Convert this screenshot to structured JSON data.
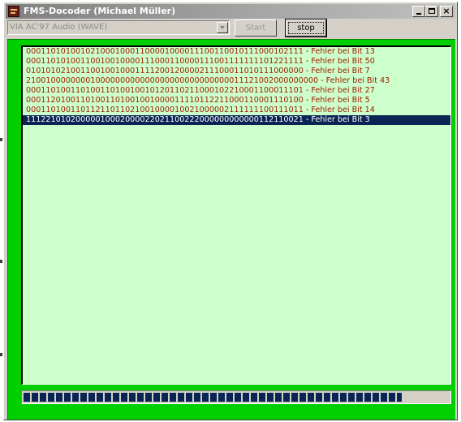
{
  "window": {
    "title": "FMS-Docoder (Michael Müller)",
    "icon": "app-icon",
    "controls": {
      "minimize": "minimize-icon",
      "maximize": "maximize-icon",
      "close": "×"
    }
  },
  "toolbar": {
    "device_value": "VIA AC'97 Audio (WAVE)",
    "start_label": "Start",
    "stop_label": "stop"
  },
  "results": [
    "00011010100102100010001100001000011100110010111000102111 - Fehler bei Bit 13",
    "00011010100110010010000111000110000111001111111101221111 - Fehler bei Bit 50",
    "01010102100110010010001111200120000211100011010111000000 - Fehler bei Bit 7",
    "21001000000001000000000000000000000000000011121002000000000 - Fehler bei Bit 43",
    "00011010011010011010010010120110211000102210001100011101 - Fehler bei Bit 27",
    "00011201001101001101001001000011110112211000110001110100 - Fehler bei Bit 5",
    "00011010011011211011021001000010021000002111111100111011 - Fehler bei Bit 14",
    "11122101020000010002000022021100222000000000000112110021 - Fehler bei Bit 3"
  ],
  "selected_index": 7,
  "progress": {
    "fraction": 0.89
  },
  "colors": {
    "panel": "#00d000",
    "list_background": "#ccffcc",
    "list_text": "#a02000",
    "selection": "#0a2454",
    "progress_fill": "#0a2454"
  }
}
